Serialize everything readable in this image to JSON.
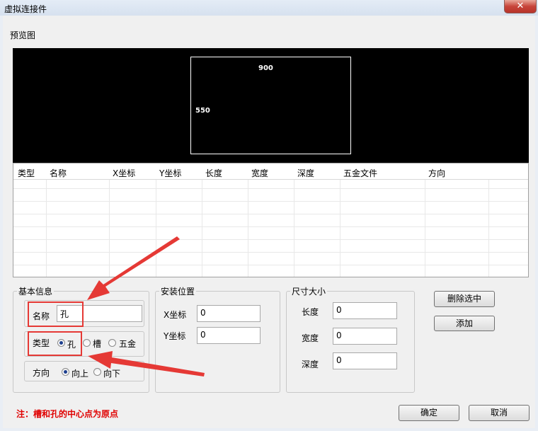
{
  "window": {
    "title": "虚拟连接件",
    "close_glyph": "✕"
  },
  "preview": {
    "label": "预览图",
    "width_dim": "900",
    "height_dim": "550"
  },
  "table": {
    "columns": [
      "类型",
      "名称",
      "X坐标",
      "Y坐标",
      "长度",
      "宽度",
      "深度",
      "五金文件",
      "方向"
    ]
  },
  "basic_info": {
    "title": "基本信息",
    "name_label": "名称",
    "name_value": "孔",
    "type_label": "类型",
    "type_options": [
      "孔",
      "槽",
      "五金"
    ],
    "type_selected": "孔",
    "direction_label": "方向",
    "direction_options": [
      "向上",
      "向下"
    ],
    "direction_selected": "向上"
  },
  "install_position": {
    "title": "安装位置",
    "x_label": "X坐标",
    "x_value": "0",
    "y_label": "Y坐标",
    "y_value": "0"
  },
  "size": {
    "title": "尺寸大小",
    "length_label": "长度",
    "length_value": "0",
    "width_label": "宽度",
    "width_value": "0",
    "depth_label": "深度",
    "depth_value": "0"
  },
  "buttons": {
    "delete_selected": "删除选中",
    "add": "添加",
    "ok": "确定",
    "cancel": "取消"
  },
  "note": "注：槽和孔的中心点为原点",
  "colors": {
    "annotation_red": "#e53935",
    "note_red": "#e00000"
  }
}
